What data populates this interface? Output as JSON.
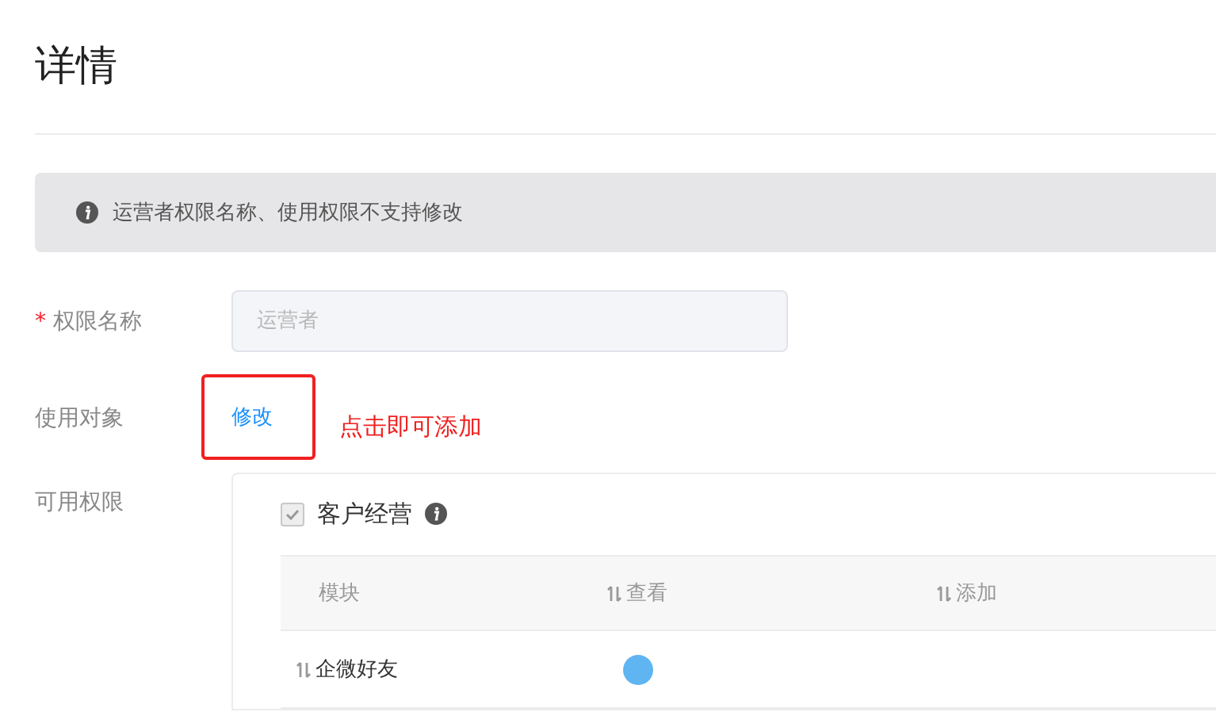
{
  "title": "详情",
  "notice": {
    "text": "运营者权限名称、使用权限不支持修改"
  },
  "form": {
    "name_field": {
      "label": "权限名称",
      "required_mark": "*",
      "placeholder": "运营者"
    },
    "target": {
      "label": "使用对象",
      "link": "修改",
      "annotation": "点击即可添加"
    },
    "permissions": {
      "label": "可用权限",
      "group": {
        "title": "客户经营",
        "checked": true
      },
      "columns": [
        "模块",
        "查看",
        "添加"
      ],
      "rows": [
        {
          "module": "企微好友",
          "view": true
        }
      ]
    }
  }
}
